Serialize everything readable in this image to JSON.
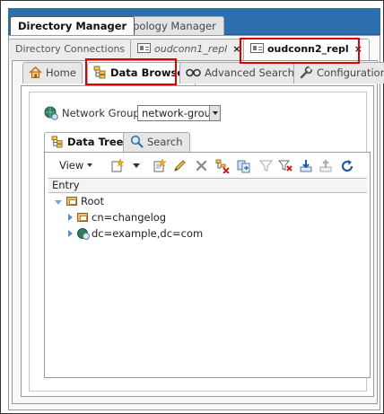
{
  "main_tabs": [
    {
      "label": "Directory Manager"
    },
    {
      "label": "Topology Manager"
    }
  ],
  "connection_tabs": [
    {
      "label": "Directory Connections"
    },
    {
      "label": "oudconn1_repl"
    },
    {
      "label": "oudconn2_repl"
    }
  ],
  "nav_tabs": [
    {
      "label": "Home"
    },
    {
      "label": "Data Browser"
    },
    {
      "label": "Advanced Search"
    },
    {
      "label": "Configuration"
    }
  ],
  "network_group": {
    "label": "Network Group",
    "value": "network-group"
  },
  "tree_tabs": [
    {
      "label": "Data Tree"
    },
    {
      "label": "Search"
    }
  ],
  "toolbar": {
    "view_label": "View"
  },
  "tree": {
    "header": "Entry",
    "nodes": [
      {
        "label": "Root"
      },
      {
        "label": "cn=changelog"
      },
      {
        "label": "dc=example,dc=com"
      }
    ]
  },
  "colors": {
    "tab_bar": "#2d6fad",
    "highlight": "#e00000"
  }
}
